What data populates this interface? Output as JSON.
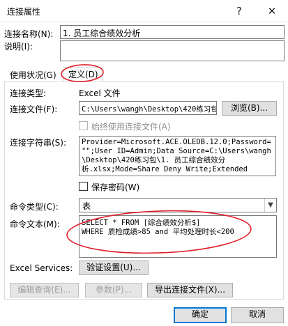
{
  "window": {
    "title": "连接属性",
    "help_glyph": "?",
    "close_glyph": "✕"
  },
  "connection": {
    "name_label": "连接名称(N):",
    "name_value": "1. 员工综合绩效分析",
    "desc_label": "说明(I):",
    "desc_value": ""
  },
  "tabs": [
    {
      "label": "使用状况(G)",
      "active": false
    },
    {
      "label": "定义(D)",
      "active": true
    }
  ],
  "definition": {
    "conn_type_label": "连接类型:",
    "conn_type_value": "Excel 文件",
    "conn_file_label": "连接文件(F):",
    "conn_file_value": "C:\\Users\\wangh\\Desktop\\420练习包",
    "browse_label": "浏览(B)...",
    "always_use_label": "始终使用连接文件(A)",
    "conn_string_label": "连接字符串(S):",
    "conn_string_lines": [
      "Provider=Microsoft.ACE.OLEDB.12.0;Password=",
      "\"\";User ID=Admin;Data Source=C:\\Users\\wangh",
      "\\Desktop\\420练习包\\1. 员工综合绩效分",
      "析.xlsx;Mode=Share Deny Write;Extended"
    ],
    "save_password_label": "保存密码(W)",
    "cmd_type_label": "命令类型(C):",
    "cmd_type_value": "表",
    "cmd_text_label": "命令文本(M):",
    "cmd_text_lines": [
      "SELECT * FROM [综合绩效分析$]",
      "WHERE 质检成绩>85 and 平均处理时长<200"
    ],
    "excel_services_label": "Excel Services:",
    "auth_settings_label": "验证设置(U)...",
    "edit_query_label": "编辑查询(E)...",
    "params_label": "参数(P)...",
    "export_label": "导出连接文件(X)..."
  },
  "footer": {
    "ok_label": "确定",
    "cancel_label": "取消"
  },
  "colors": {
    "annotation": "#e0202a",
    "accent": "#0078d7"
  }
}
